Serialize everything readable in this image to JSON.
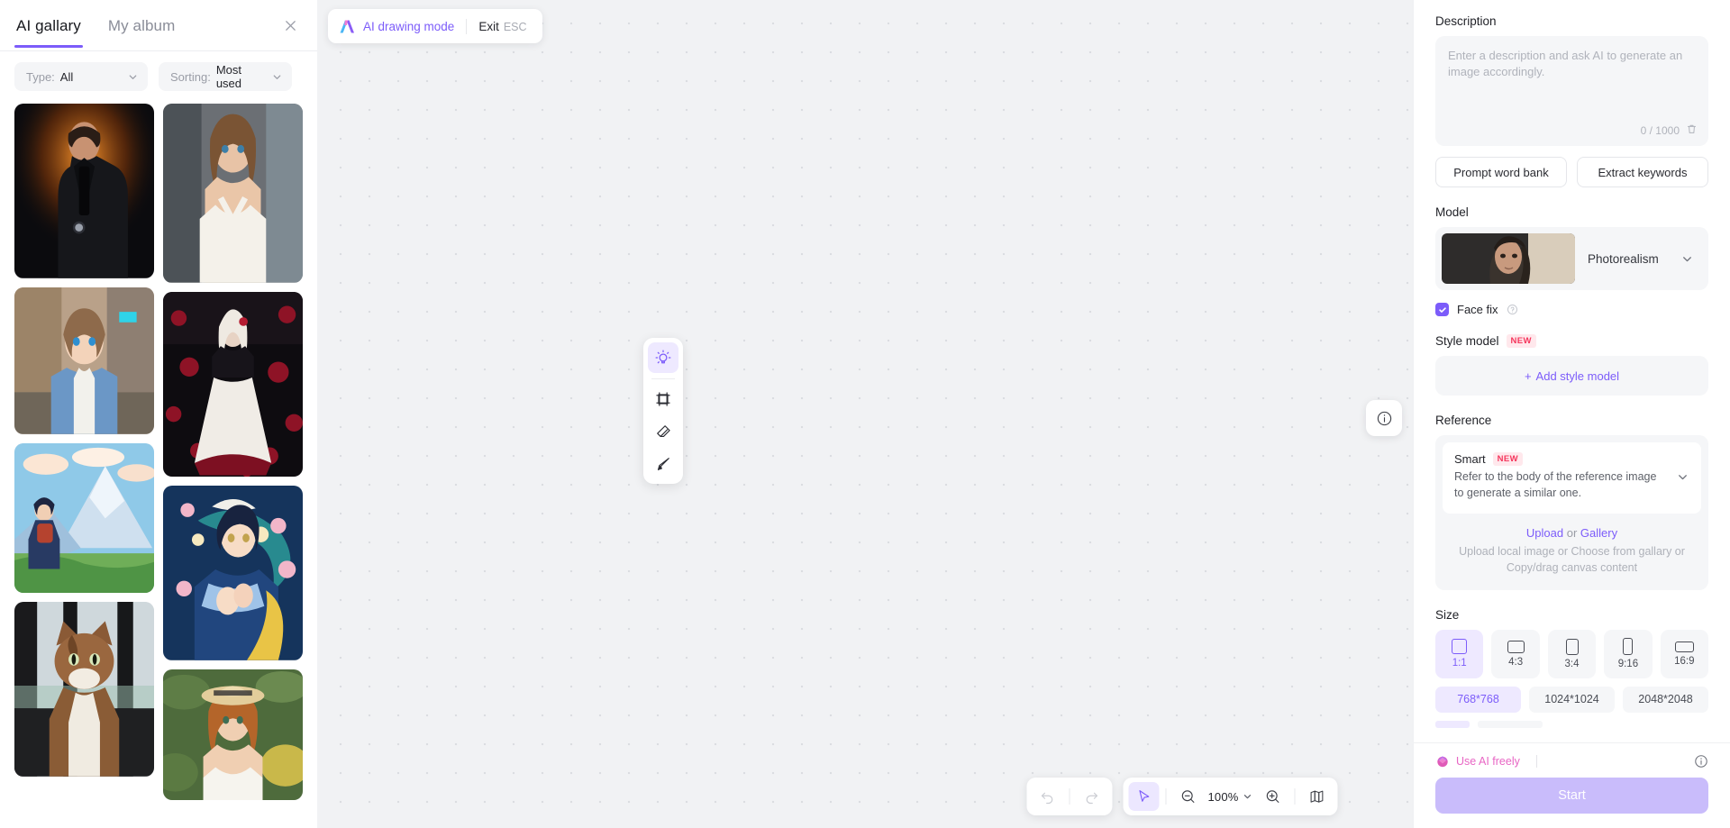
{
  "gallery": {
    "tabs": [
      {
        "label": "AI gallary",
        "active": true
      },
      {
        "label": "My album",
        "active": false
      }
    ],
    "close_icon": "close-icon",
    "filters": {
      "type": {
        "label": "Type:",
        "value": "All"
      },
      "sorting": {
        "label": "Sorting:",
        "value": "Most used"
      }
    },
    "items": [
      {
        "name": "man-in-black-suit",
        "col": 1
      },
      {
        "name": "woman-in-white-lace-dress",
        "col": 2
      },
      {
        "name": "anime-girl-denim-jacket-street",
        "col": 1
      },
      {
        "name": "gothic-girl-with-roses",
        "col": 2
      },
      {
        "name": "anime-girl-mountain-landscape",
        "col": 1
      },
      {
        "name": "anime-girl-with-flowers-feathers",
        "col": 2
      },
      {
        "name": "tabby-cat-by-window",
        "col": 1
      },
      {
        "name": "woman-with-straw-hat",
        "col": 2
      }
    ]
  },
  "canvas": {
    "mode_chip": {
      "logo_icon": "ai-logo-icon",
      "label": "AI drawing mode",
      "exit_label": "Exit",
      "exit_shortcut": "ESC"
    },
    "tools": [
      {
        "name": "idea-lightbulb-tool",
        "icon": "lightbulb-icon",
        "active": true
      },
      {
        "name": "frame-tool",
        "icon": "frame-icon",
        "active": false
      },
      {
        "name": "eraser-tool",
        "icon": "eraser-icon",
        "active": false
      },
      {
        "name": "pen-tool",
        "icon": "pen-icon",
        "active": false
      }
    ],
    "info_fab_icon": "info-circle-icon",
    "bottom_bar": {
      "undo": {
        "label": "Undo",
        "icon": "undo-icon",
        "disabled": true
      },
      "redo": {
        "label": "Redo",
        "icon": "redo-icon",
        "disabled": true
      },
      "select": {
        "label": "Select",
        "icon": "cursor-arrow-icon",
        "active": true
      },
      "zoom_out": {
        "label": "Zoom out",
        "icon": "zoom-out-icon"
      },
      "zoom_level": "100%",
      "zoom_in": {
        "label": "Zoom in",
        "icon": "zoom-in-icon"
      },
      "minimap": {
        "label": "Minimap",
        "icon": "map-icon"
      }
    }
  },
  "panel": {
    "description": {
      "label": "Description",
      "placeholder": "Enter a description and ask AI to generate an image accordingly.",
      "value": "",
      "counter": "0 / 1000",
      "clear_icon": "trash-icon"
    },
    "prompt_word_bank_label": "Prompt word bank",
    "extract_keywords_label": "Extract keywords",
    "model": {
      "label": "Model",
      "selected": "Photorealism",
      "chevron_icon": "chevron-down-icon",
      "thumb_name": "model-preview-photorealism"
    },
    "face_fix": {
      "label": "Face fix",
      "checked": true,
      "help_icon": "help-circle-icon"
    },
    "style_model": {
      "label": "Style model",
      "badge": "NEW",
      "add_label": "Add style model",
      "add_icon": "plus-icon"
    },
    "reference": {
      "label": "Reference",
      "mode_title": "Smart",
      "mode_badge": "NEW",
      "mode_desc": "Refer to the body of the reference image to generate a similar one.",
      "chevron_icon": "chevron-down-icon",
      "upload_label": "Upload",
      "or_label": "or",
      "gallery_label": "Gallery",
      "hint": "Upload local image or Choose from gallary or Copy/drag canvas content"
    },
    "size": {
      "label": "Size",
      "ratios": [
        {
          "label": "1:1",
          "w": 17,
          "h": 17,
          "selected": true
        },
        {
          "label": "4:3",
          "w": 19,
          "h": 14,
          "selected": false
        },
        {
          "label": "3:4",
          "w": 14,
          "h": 18,
          "selected": false
        },
        {
          "label": "9:16",
          "w": 11,
          "h": 19,
          "selected": false
        },
        {
          "label": "16:9",
          "w": 21,
          "h": 12,
          "selected": false
        }
      ],
      "resolutions": [
        {
          "label": "768*768",
          "selected": true
        },
        {
          "label": "1024*1024",
          "selected": false
        },
        {
          "label": "2048*2048",
          "selected": false
        }
      ]
    },
    "footer": {
      "free_label": "Use AI freely",
      "free_icon": "gem-icon",
      "info_icon": "info-circle-icon",
      "start_label": "Start"
    }
  },
  "colors": {
    "accent": "#7c5cfa",
    "accent_soft": "#eee9ff",
    "badge_new_bg": "#ffe8ec",
    "badge_new_fg": "#f5365c",
    "free_pink": "#e866c4",
    "start_btn": "#c9bcfb",
    "canvas_bg": "#f1f2f4"
  }
}
